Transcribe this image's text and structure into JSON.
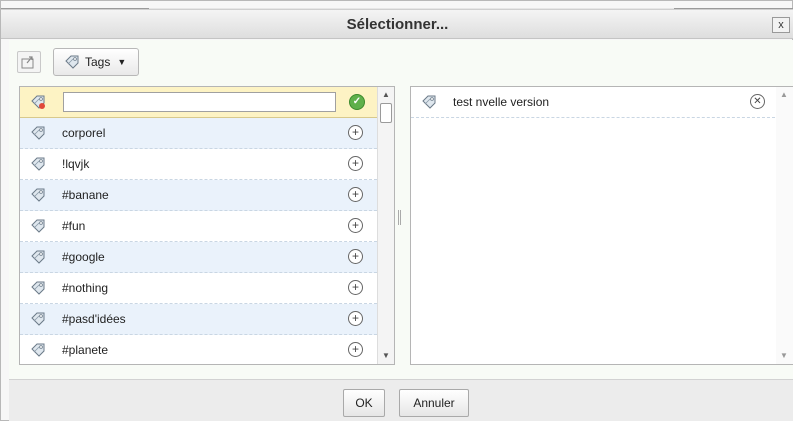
{
  "dialog": {
    "title": "Sélectionner...",
    "close_label": "x"
  },
  "toolbar": {
    "tags_label": "Tags"
  },
  "tag_list": {
    "search_value": "",
    "items": [
      {
        "label": "corporel"
      },
      {
        "label": "!lqvjk"
      },
      {
        "label": "#banane"
      },
      {
        "label": "#fun"
      },
      {
        "label": "#google"
      },
      {
        "label": "#nothing"
      },
      {
        "label": "#pasd'idées"
      },
      {
        "label": "#planete"
      }
    ]
  },
  "selected": {
    "items": [
      {
        "label": "test nvelle version"
      }
    ]
  },
  "buttons": {
    "ok": "OK",
    "cancel": "Annuler"
  },
  "colors": {
    "row_alt": "#eaf2fb",
    "input_row": "#fdf3c4",
    "check": "#5fb04b"
  }
}
